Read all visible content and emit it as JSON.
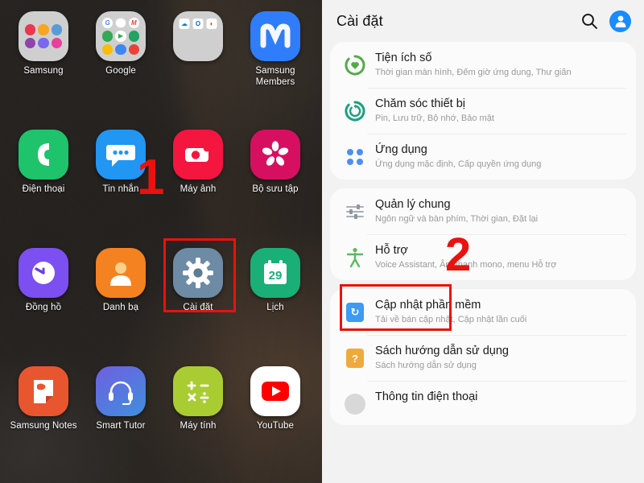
{
  "home_screen": {
    "apps": [
      {
        "label": "Samsung",
        "type": "folder",
        "icon": "samsung-folder-icon",
        "mini_colors": [
          "#e8384f",
          "#f5a623",
          "#5b9bd5",
          "#8e44ad",
          "#7b68ee",
          "#e8409a"
        ]
      },
      {
        "label": "Google",
        "type": "folder",
        "icon": "google-folder-icon",
        "mini_colors": [
          "#4285f4",
          "#ea4335",
          "#ea4335",
          "#34a853",
          "#34a853",
          "#fbbc05",
          "#ea4335",
          "#4285f4",
          "#ea4335"
        ]
      },
      {
        "label": "",
        "type": "folder",
        "icon": "microsoft-folder-icon",
        "mini_colors": [
          "#0f7ec8",
          "#0f6cbd",
          "#d83b01"
        ]
      },
      {
        "label": "Samsung Members",
        "type": "app",
        "icon": "samsung-members-icon",
        "color": "#2f7dfb",
        "glyph": "M"
      },
      {
        "label": "Điện thoại",
        "type": "app",
        "icon": "phone-icon",
        "color": "#1ec36b",
        "glyph": "phone"
      },
      {
        "label": "Tin nhắn",
        "type": "app",
        "icon": "messages-icon",
        "color": "#2196f3",
        "glyph": "chat"
      },
      {
        "label": "Máy ảnh",
        "type": "app",
        "icon": "camera-icon",
        "color": "#f5163f",
        "glyph": "camera"
      },
      {
        "label": "Bộ sưu tập",
        "type": "app",
        "icon": "gallery-icon",
        "color": "#d60f60",
        "glyph": "flower"
      },
      {
        "label": "Đồng hồ",
        "type": "app",
        "icon": "clock-icon",
        "color": "#7b4ff0",
        "glyph": "clock"
      },
      {
        "label": "Danh bạ",
        "type": "app",
        "icon": "contacts-icon",
        "color": "#f58220",
        "glyph": "person"
      },
      {
        "label": "Cài đặt",
        "type": "app",
        "icon": "settings-gear-icon",
        "color": "#6d8ba4",
        "glyph": "gear"
      },
      {
        "label": "Lịch",
        "type": "app",
        "icon": "calendar-icon",
        "color": "#1aaf76",
        "glyph": "29"
      },
      {
        "label": "Samsung Notes",
        "type": "app",
        "icon": "notes-icon",
        "color": "#e8562f",
        "glyph": "note"
      },
      {
        "label": "Smart Tutor",
        "type": "app",
        "icon": "headset-icon",
        "color": "#5577dd",
        "glyph": "headset"
      },
      {
        "label": "Máy tính",
        "type": "app",
        "icon": "calculator-icon",
        "color": "#aacc33",
        "glyph": "calc"
      },
      {
        "label": "YouTube",
        "type": "app",
        "icon": "youtube-icon",
        "color": "#ffffff",
        "glyph": "play"
      }
    ]
  },
  "settings": {
    "header": {
      "title": "Cài đặt",
      "search_icon": "search-icon",
      "avatar_icon": "account-avatar-icon"
    },
    "groups": [
      {
        "items": [
          {
            "title": "Tiện ích số",
            "subtitle": "Thời gian màn hình, Đếm giờ ứng dụng, Thư giãn",
            "icon": "digital-wellbeing-icon",
            "icon_color": "#56a94a"
          },
          {
            "title": "Chăm sóc thiết bị",
            "subtitle": "Pin, Lưu trữ, Bộ nhớ, Bảo mật",
            "icon": "device-care-icon",
            "icon_color": "#1aa080"
          },
          {
            "title": "Ứng dụng",
            "subtitle": "Ứng dụng mặc định, Cấp quyền ứng dụng",
            "icon": "apps-dots-icon",
            "icon_color": "#4d8ef7"
          }
        ]
      },
      {
        "items": [
          {
            "title": "Quản lý chung",
            "subtitle": "Ngôn ngữ và bàn phím, Thời gian, Đặt lại",
            "icon": "general-management-sliders-icon",
            "icon_color": "#a8b0b8"
          },
          {
            "title": "Hỗ trợ",
            "subtitle": "Voice Assistant, Âm thanh mono, menu Hỗ trợ",
            "icon": "accessibility-icon",
            "icon_color": "#5cb860"
          }
        ]
      },
      {
        "items": [
          {
            "title": "Cập nhật phần mềm",
            "subtitle": "Tải về bán cập nhật, Cập nhật lần cuối",
            "icon": "software-update-icon",
            "icon_color": "#3d9bf5"
          },
          {
            "title": "Sách hướng dẫn sử dụng",
            "subtitle": "Sách hướng dẫn sử dụng",
            "icon": "user-manual-icon",
            "icon_color": "#f0a93c"
          },
          {
            "title": "Thông tin điện thoại",
            "subtitle": "",
            "icon": "phone-info-icon",
            "icon_color": "#d8d8d8"
          }
        ]
      }
    ]
  },
  "annotations": {
    "color": "#e8120e",
    "step_one": {
      "label": "1",
      "target": "Cài đặt"
    },
    "step_two": {
      "label": "2",
      "target": "Hỗ trợ"
    }
  }
}
